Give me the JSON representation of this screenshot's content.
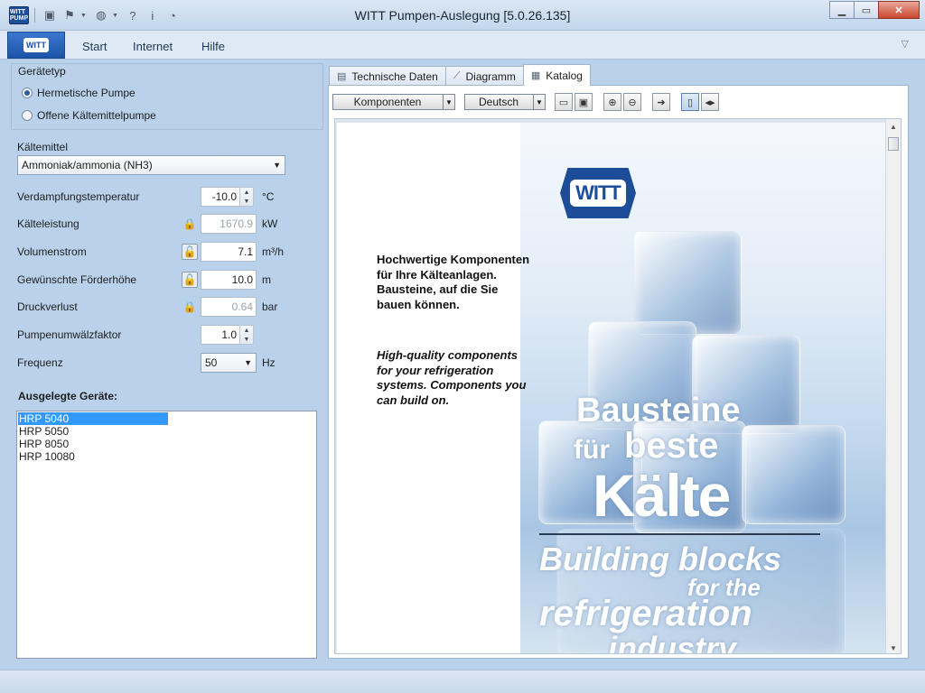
{
  "window": {
    "title": "WITT Pumpen-Auslegung [5.0.26.135]",
    "app_logo": "WITT PUMP"
  },
  "ribbon": {
    "tabs": [
      "Start",
      "Internet",
      "Hilfe"
    ],
    "app_button_logo": "WITT"
  },
  "left": {
    "device_type": {
      "label": "Gerätetyp",
      "options": [
        "Hermetische Pumpe",
        "Offene Kältemittelpumpe"
      ],
      "selected": "Hermetische Pumpe"
    },
    "refrigerant": {
      "label": "Kältemittel",
      "value": "Ammoniak/ammonia (NH3)"
    },
    "fields": {
      "evap_temp": {
        "label": "Verdampfungstemperatur",
        "value": "-10.0",
        "unit": "°C"
      },
      "capacity": {
        "label": "Kälteleistung",
        "value": "1670.9",
        "unit": "kW"
      },
      "volume_flow": {
        "label": "Volumenstrom",
        "value": "7.1",
        "unit": "m³/h"
      },
      "head": {
        "label": "Gewünschte Förderhöhe",
        "value": "10.0",
        "unit": "m"
      },
      "pressure_loss": {
        "label": "Druckverlust",
        "value": "0.64",
        "unit": "bar"
      },
      "circ_factor": {
        "label": "Pumpenumwälzfaktor",
        "value": "1.0"
      },
      "frequency": {
        "label": "Frequenz",
        "value": "50",
        "unit": "Hz"
      }
    },
    "devices": {
      "label": "Ausgelegte Geräte:",
      "items": [
        "HRP 5040",
        "HRP 5050",
        "HRP 8050",
        "HRP 10080"
      ],
      "selected_index": 0
    }
  },
  "right": {
    "tabs": [
      {
        "label": "Technische Daten",
        "icon": "calculator-icon"
      },
      {
        "label": "Diagramm",
        "icon": "chart-icon"
      },
      {
        "label": "Katalog",
        "icon": "document-icon",
        "active": true
      }
    ],
    "toolbar": {
      "section": "Komponenten",
      "language": "Deutsch"
    },
    "catalog": {
      "logo": "WITT",
      "text_de": "Hochwertige Komponenten für Ihre Kälteanlagen. Bausteine, auf die Sie bauen können.",
      "text_en": "High-quality components for your refrigeration systems. Components you can build on.",
      "headline_de_1": "Bausteine",
      "headline_de_2a": "für",
      "headline_de_2b": "beste",
      "headline_de_3": "Kälte",
      "headline_en_1": "Building blocks",
      "headline_en_2": "for the",
      "headline_en_3": "refrigeration",
      "headline_en_4": "industry"
    }
  },
  "colors": {
    "accent": "#1d4d98",
    "selection": "#3399ff",
    "frame": "#b9d1ea"
  }
}
